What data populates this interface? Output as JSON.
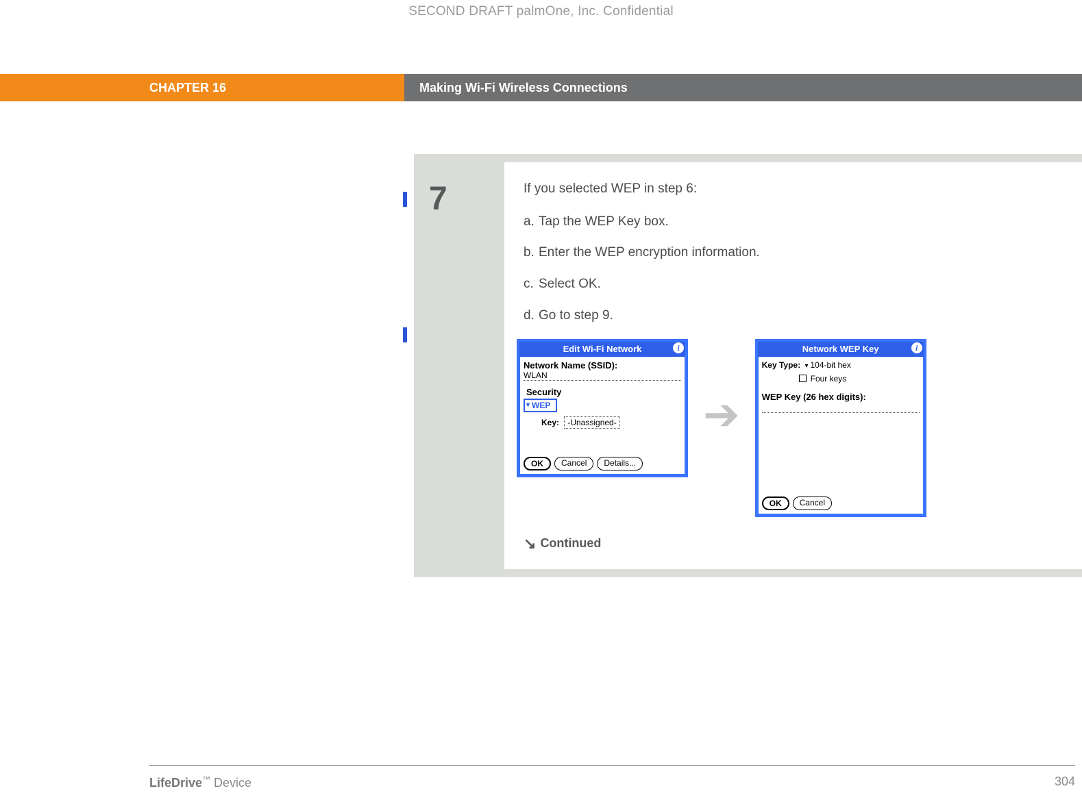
{
  "draft_header": "SECOND DRAFT palmOne, Inc.  Confidential",
  "chapter_label": "CHAPTER 16",
  "chapter_title": "Making Wi-Fi Wireless Connections",
  "step": {
    "number": "7",
    "intro": "If you selected WEP in step 6:",
    "items": {
      "a": "Tap the WEP Key box.",
      "b": "Enter the WEP encryption information.",
      "c": "Select OK.",
      "d": "Go to step 9."
    },
    "continued": "Continued"
  },
  "palm_left": {
    "title": "Edit Wi-Fi Network",
    "ssid_label": "Network Name (SSID):",
    "ssid_value": "WLAN",
    "security_label": "Security",
    "security_value": "WEP",
    "key_label": "Key:",
    "key_value": "-Unassigned-",
    "buttons": {
      "ok": "OK",
      "cancel": "Cancel",
      "details": "Details..."
    }
  },
  "palm_right": {
    "title": "Network WEP Key",
    "keytype_label": "Key Type:",
    "keytype_value": "104-bit hex",
    "fourkeys_label": "Four keys",
    "wepkey_label": "WEP Key (26 hex digits):",
    "buttons": {
      "ok": "OK",
      "cancel": "Cancel"
    }
  },
  "footer": {
    "product_bold": "LifeDrive",
    "product_rest": "Device",
    "tm": "™",
    "page": "304"
  }
}
